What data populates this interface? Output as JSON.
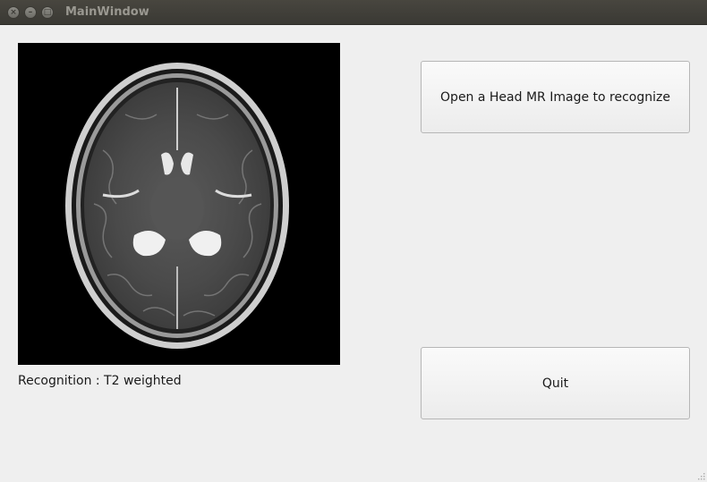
{
  "window": {
    "title": "MainWindow"
  },
  "image": {
    "icon": "mri-brain-image"
  },
  "result": {
    "text": "Recognition : T2 weighted"
  },
  "buttons": {
    "open_label": "Open a Head MR Image to recognize",
    "quit_label": "Quit"
  },
  "colors": {
    "window_bg": "#efefef",
    "titlebar_bg": "#3c3b37",
    "title_text": "#9a9891",
    "image_bg": "#000000"
  }
}
